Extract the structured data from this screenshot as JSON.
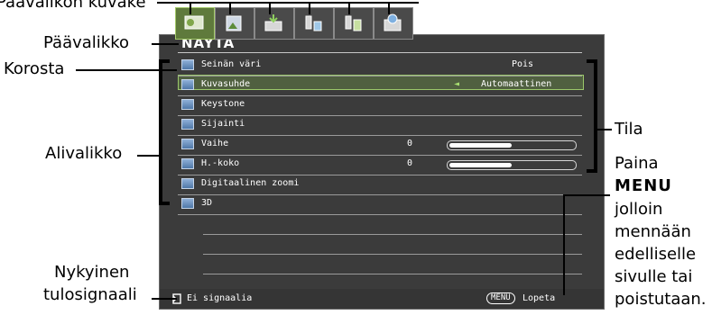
{
  "callouts": {
    "main_menu_icon": "Päävalikon kuvake",
    "main_menu": "Päävalikko",
    "highlight": "Korosta",
    "submenu": "Alivalikko",
    "current_input_line1": "Nykyinen",
    "current_input_line2": "tulosignaali",
    "status": "Tila",
    "press_line1": "Paina",
    "press_bold": "MENU",
    "press_line3": "jolloin",
    "press_line4": "mennään",
    "press_line5": "edelliselle",
    "press_line6": "sivulle tai",
    "press_line7": "poistutaan."
  },
  "osd": {
    "title": "NÄYTÄ",
    "rows": [
      {
        "label": "Seinän väri",
        "value": "Pois"
      },
      {
        "label": "Kuvasuhde",
        "value": "Automaattinen",
        "selected": true
      },
      {
        "label": "Keystone"
      },
      {
        "label": "Sijainti"
      },
      {
        "label": "Vaihe",
        "value": "0",
        "slider": 0.5
      },
      {
        "label": "H.-koko",
        "value": "0",
        "slider": 0.5
      },
      {
        "label": "Digitaalinen zoomi"
      },
      {
        "label": "3D"
      }
    ],
    "status_text": "Ei signaalia",
    "menu_key": "MENU",
    "exit_text": "Lopeta"
  },
  "tab_icons": [
    "display-icon",
    "picture-icon",
    "source-icon",
    "system-setup-basic-icon",
    "system-setup-advanced-icon",
    "information-icon"
  ],
  "colors": {
    "osd_background": "#3b3b3b",
    "highlight_fill": "#506040",
    "highlight_border": "#9bc86a",
    "active_tab": "#5f7a3c"
  }
}
